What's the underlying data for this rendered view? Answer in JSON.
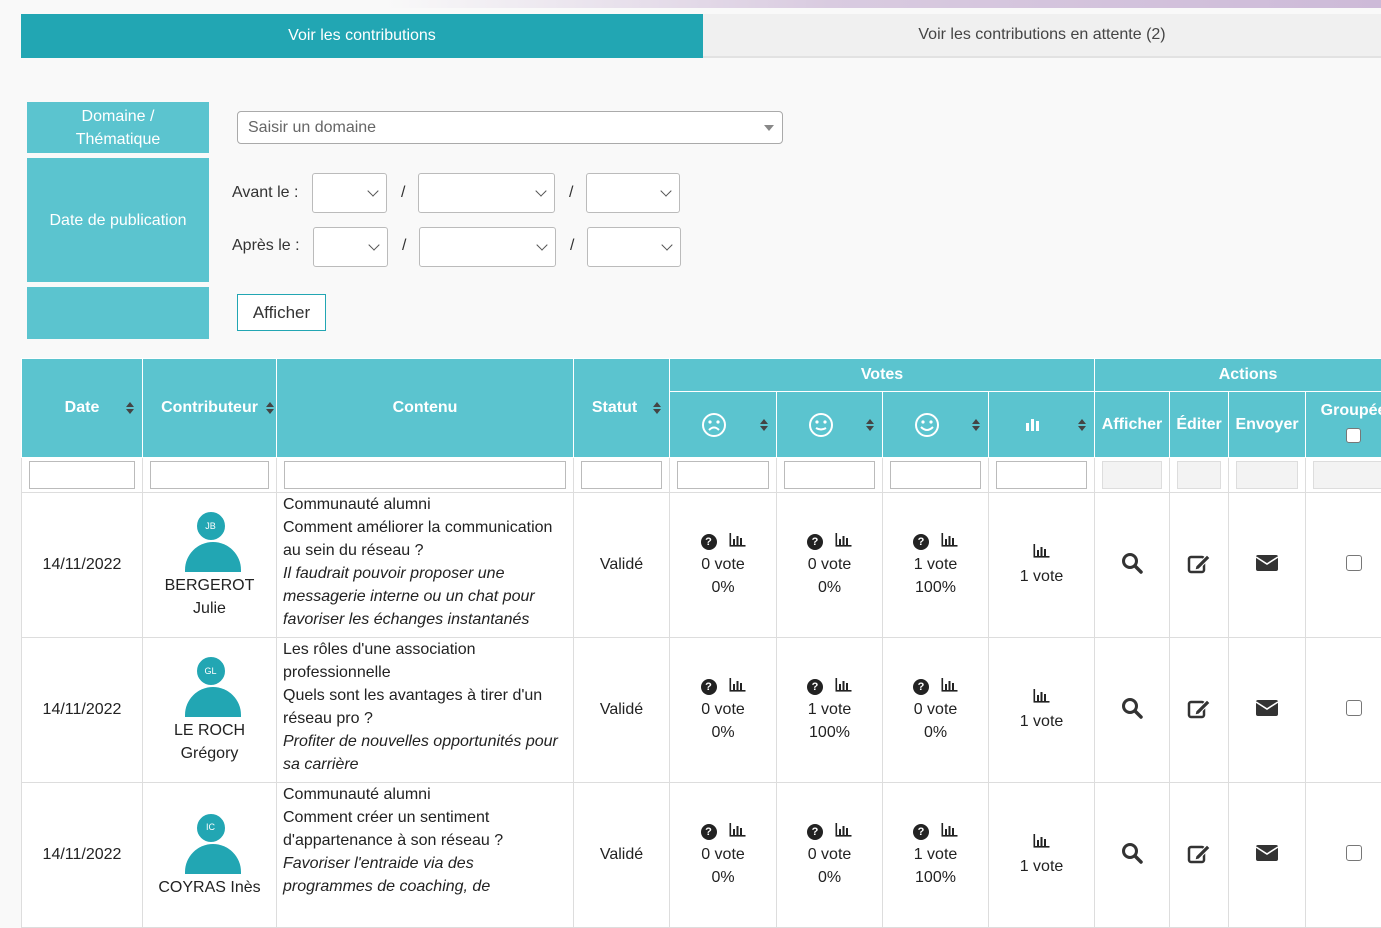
{
  "tabs": [
    {
      "label": "Voir les contributions"
    },
    {
      "label": "Voir les contributions en attente (2)"
    }
  ],
  "filters": {
    "domain_label": "Domaine /\nThématique",
    "domain_placeholder": "Saisir un domaine",
    "date_label": "Date de publication",
    "before_label": "Avant le :",
    "after_label": "Après le :",
    "separator": "/",
    "submit_label": "Afficher"
  },
  "table": {
    "headers": {
      "date": "Date",
      "contributor": "Contributeur",
      "content": "Contenu",
      "status": "Statut",
      "votes": "Votes",
      "actions": "Actions",
      "show": "Afficher",
      "edit": "Éditer",
      "send": "Envoyer",
      "grouped": "Groupée"
    },
    "rows": [
      {
        "date": "14/11/2022",
        "initials": "JB",
        "last": "BERGEROT",
        "first": "Julie",
        "domain": "Communauté alumni",
        "question": "Comment améliorer la communication au sein du réseau ?",
        "answer": "Il faudrait pouvoir proposer une messagerie interne ou un chat pour favoriser les échanges instantanés",
        "status": "Validé",
        "votes": [
          {
            "count": "0 vote",
            "pct": "0%"
          },
          {
            "count": "0 vote",
            "pct": "0%"
          },
          {
            "count": "1 vote",
            "pct": "100%"
          }
        ],
        "total": "1 vote"
      },
      {
        "date": "14/11/2022",
        "initials": "GL",
        "last": "LE ROCH",
        "first": "Grégory",
        "domain": "Les rôles d'une association professionnelle",
        "question": "Quels sont les avantages à tirer d'un réseau pro ?",
        "answer": "Profiter de nouvelles opportunités pour sa carrière",
        "status": "Validé",
        "votes": [
          {
            "count": "0 vote",
            "pct": "0%"
          },
          {
            "count": "1 vote",
            "pct": "100%"
          },
          {
            "count": "0 vote",
            "pct": "0%"
          }
        ],
        "total": "1 vote"
      },
      {
        "date": "14/11/2022",
        "initials": "IC",
        "last": "COYRAS Inès",
        "first": "",
        "domain": "Communauté alumni",
        "question": "Comment créer un sentiment d'appartenance à son réseau ?",
        "answer": "Favoriser l'entraide via des programmes de coaching, de",
        "status": "Validé",
        "votes": [
          {
            "count": "0 vote",
            "pct": "0%"
          },
          {
            "count": "0 vote",
            "pct": "0%"
          },
          {
            "count": "1 vote",
            "pct": "100%"
          }
        ],
        "total": "1 vote"
      }
    ]
  },
  "colors": {
    "primary": "#22a6b3",
    "header": "#5bc4cf"
  }
}
